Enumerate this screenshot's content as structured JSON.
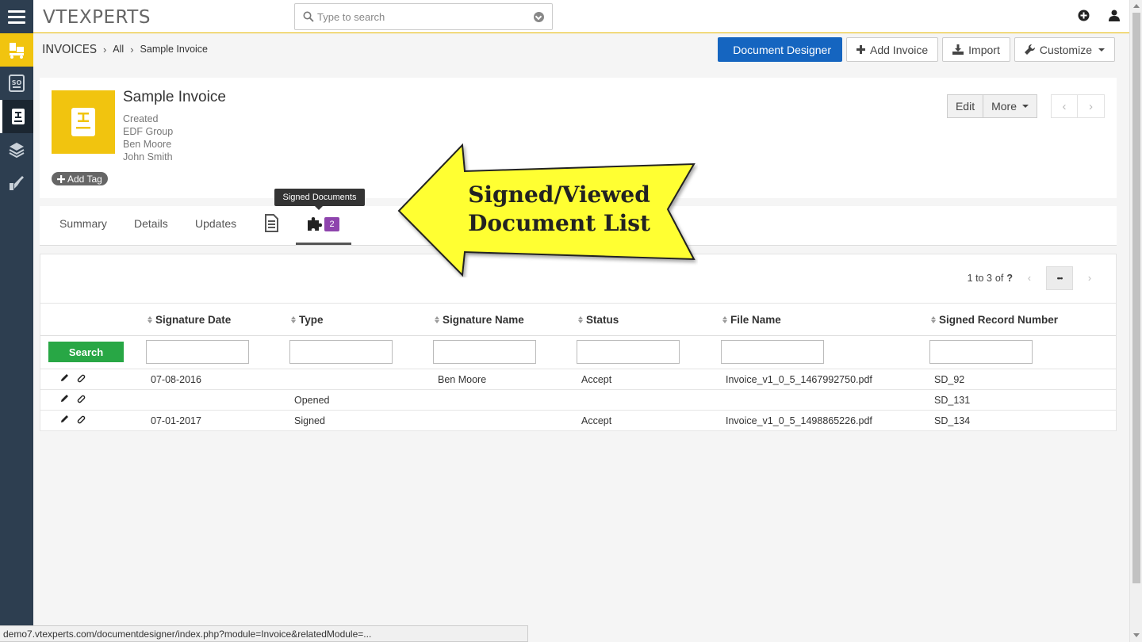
{
  "app": {
    "logo": "VTEXPERTS"
  },
  "search": {
    "placeholder": "Type to search"
  },
  "breadcrumb": {
    "module": "INVOICES",
    "filter": "All",
    "record": "Sample Invoice"
  },
  "toolbar": {
    "document_designer": "Document Designer",
    "add_invoice": "Add Invoice",
    "import": "Import",
    "customize": "Customize"
  },
  "record": {
    "title": "Sample Invoice",
    "lines": [
      "Created",
      "EDF Group",
      "Ben Moore",
      "John Smith"
    ],
    "add_tag": "Add Tag",
    "edit": "Edit",
    "more": "More"
  },
  "tabs": {
    "summary": "Summary",
    "details": "Details",
    "updates": "Updates",
    "signed_badge": "2",
    "tooltip": "Signed Documents"
  },
  "callout": {
    "line1": "Signed/Viewed",
    "line2": "Document List"
  },
  "list": {
    "pager_range": "1 to 3",
    "pager_of": "of",
    "pager_total": "?",
    "pager_more": "•••",
    "search_button": "Search",
    "columns": [
      "Signature Date",
      "Type",
      "Signature Name",
      "Status",
      "File Name",
      "Signed Record Number"
    ],
    "rows": [
      [
        "07-08-2016",
        "",
        "Ben Moore",
        "Accept",
        "Invoice_v1_0_5_1467992750.pdf",
        "SD_92"
      ],
      [
        "",
        "Opened",
        "",
        "",
        "",
        "SD_131"
      ],
      [
        "07-01-2017",
        "Signed",
        "",
        "Accept",
        "Invoice_v1_0_5_1498865226.pdf",
        "SD_134"
      ]
    ]
  },
  "status_bar": "demo7.vtexperts.com/documentdesigner/index.php?module=Invoice&relatedModule=...",
  "colors": {
    "accent_yellow": "#f1c40f",
    "rail": "#2d3e50",
    "primary": "#1565c0",
    "search_green": "#28a745",
    "badge": "#8e44ad",
    "callout": "#ffff33"
  }
}
